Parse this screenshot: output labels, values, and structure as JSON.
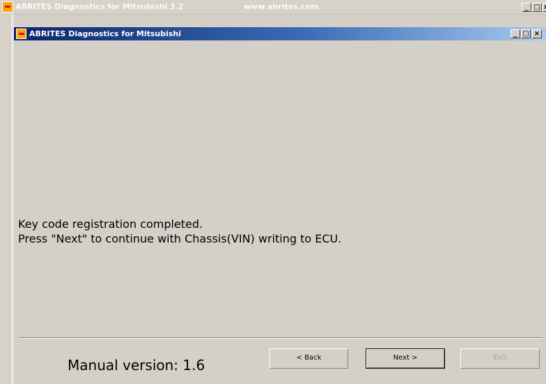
{
  "outer_window": {
    "title": "ABRITES Diagnostics for Mitsubishi 3.2",
    "url": "www.abrites.com",
    "controls": {
      "minimize": "_",
      "maximize": "□",
      "close": "×"
    }
  },
  "inner_window": {
    "title": "ABRITES Diagnostics for Mitsubishi",
    "controls": {
      "minimize": "_",
      "maximize": "□",
      "close": "×"
    }
  },
  "message": {
    "line1": "Key code registration completed.",
    "line2": "Press \"Next\" to continue with Chassis(VIN) writing to ECU."
  },
  "footer": {
    "manual_version": "Manual version: 1.6",
    "back_label": "< Back",
    "next_label": "Next >",
    "exit_label": "Exit"
  }
}
